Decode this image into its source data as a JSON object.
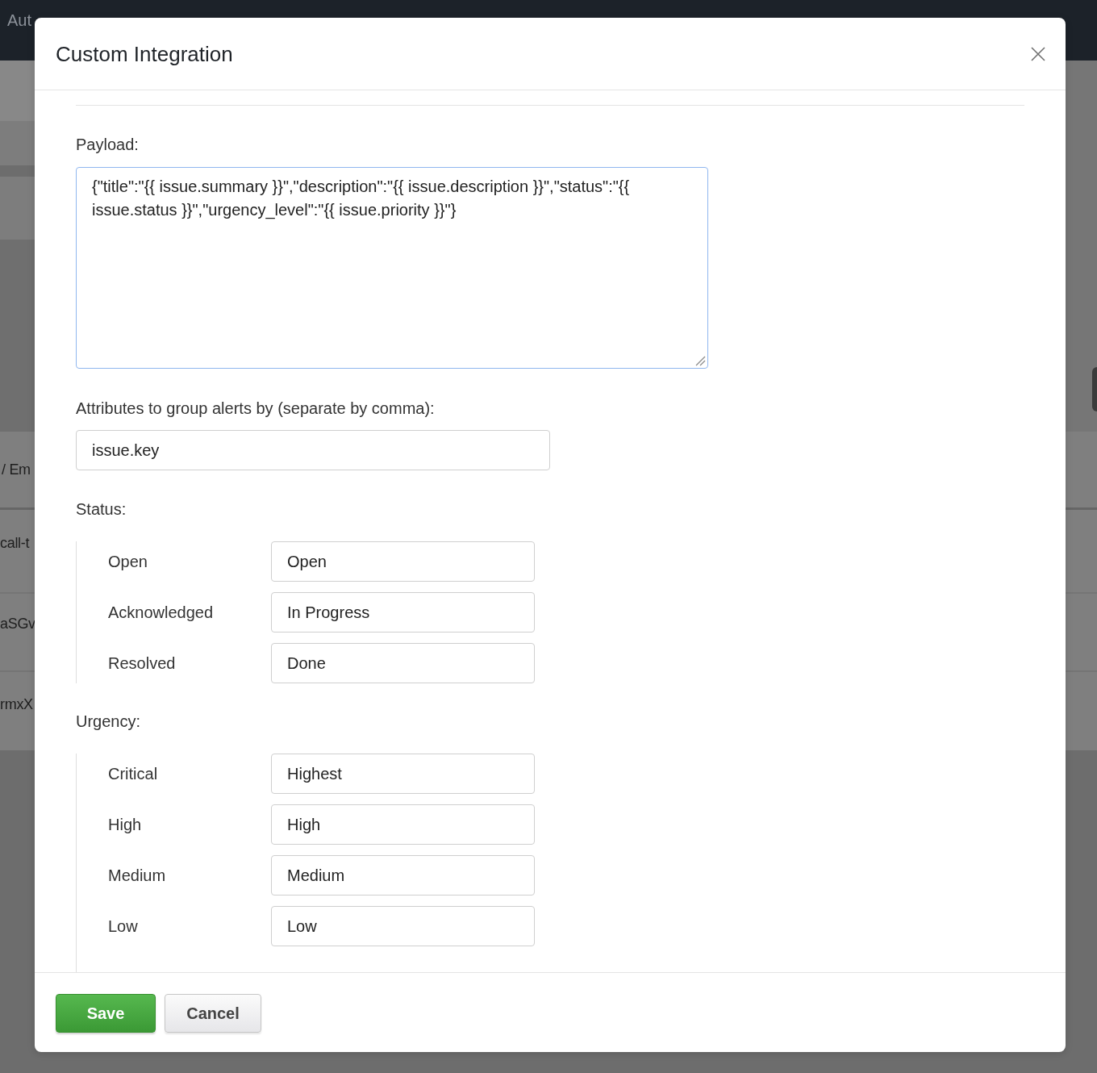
{
  "backdrop": {
    "nav_items": [
      "Aut"
    ],
    "row_fragments": [
      "/ Em",
      "call-t",
      "aSGv",
      "rmxX"
    ]
  },
  "modal": {
    "title": "Custom Integration",
    "payload": {
      "label": "Payload:",
      "value": "{\"title\":\"{{ issue.summary }}\",\"description\":\"{{ issue.description }}\",\"status\":\"{{ issue.status }}\",\"urgency_level\":\"{{ issue.priority }}\"}",
      "focused": true
    },
    "group_by": {
      "label": "Attributes to group alerts by (separate by comma):",
      "value": "issue.key"
    },
    "status": {
      "label": "Status:",
      "mappings": [
        {
          "label": "Open",
          "value": "Open"
        },
        {
          "label": "Acknowledged",
          "value": "In Progress"
        },
        {
          "label": "Resolved",
          "value": "Done"
        }
      ]
    },
    "urgency": {
      "label": "Urgency:",
      "mappings": [
        {
          "label": "Critical",
          "value": "Highest"
        },
        {
          "label": "High",
          "value": "High"
        },
        {
          "label": "Medium",
          "value": "Medium"
        },
        {
          "label": "Low",
          "value": "Low"
        }
      ]
    },
    "buttons": [
      {
        "label": "Save",
        "kind": "primary"
      },
      {
        "label": "Cancel",
        "kind": "secondary"
      }
    ]
  }
}
